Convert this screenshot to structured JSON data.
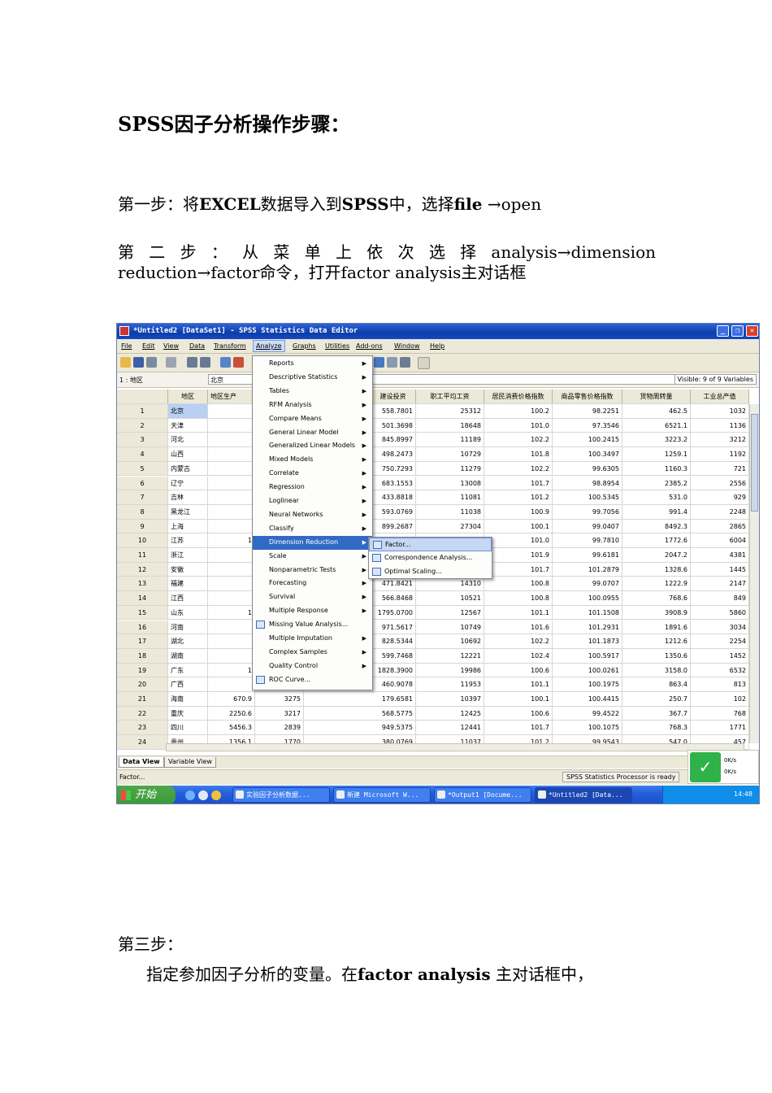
{
  "doc": {
    "heading": "SPSS因子分析操作步骤：",
    "step1_a": "第一步：将",
    "step1_b": "EXCEL",
    "step1_c": "数据导入到",
    "step1_d": "SPSS",
    "step1_e": "中，选择",
    "step1_f": "file",
    "step1_g": "→open",
    "step2": "第 二 步 ： 从 菜 单 上 依 次 选 择 analysis→dimension reduction→factor命令，打开factor analysis主对话框",
    "step3_title": "第三步：",
    "step3_a": "指定参加因子分析的变量。在",
    "step3_b": "factor analysis",
    "step3_c": "主对话框中，"
  },
  "app": {
    "title": "*Untitled2 [DataSet1] - SPSS Statistics Data Editor",
    "menus": [
      "File",
      "Edit",
      "View",
      "Data",
      "Transform",
      "Analyze",
      "Graphs",
      "Utilities",
      "Add-ons",
      "Window",
      "Help"
    ],
    "cell_ref": "1 : 地区",
    "cell_value": "北京",
    "visible": "Visible: 9 of 9 Variables",
    "columns": [
      "地区",
      "地区生产",
      "",
      "建设投资",
      "职工平均工资",
      "居民消费价格指数",
      "商品零售价格指数",
      "货物周转量",
      "工业总产值"
    ],
    "rows": [
      {
        "n": "1",
        "region": "北京",
        "gdp": "",
        "c3": "",
        "inv": "558.7801",
        "wage": "25312",
        "cpi": "100.2",
        "rpi": "98.2251",
        "freight": "462.5",
        "ind": "1032"
      },
      {
        "n": "2",
        "region": "天津",
        "gdp": "",
        "c3": "",
        "inv": "501.3698",
        "wage": "18648",
        "cpi": "101.0",
        "rpi": "97.3546",
        "freight": "6521.1",
        "ind": "1136"
      },
      {
        "n": "3",
        "region": "河北",
        "gdp": "",
        "c3": "",
        "inv": "845.8997",
        "wage": "11189",
        "cpi": "102.2",
        "rpi": "100.2415",
        "freight": "3223.2",
        "ind": "3212"
      },
      {
        "n": "4",
        "region": "山西",
        "gdp": "",
        "c3": "",
        "inv": "498.2473",
        "wage": "10729",
        "cpi": "101.8",
        "rpi": "100.3497",
        "freight": "1259.1",
        "ind": "1192"
      },
      {
        "n": "5",
        "region": "内蒙古",
        "gdp": "",
        "c3": "",
        "inv": "750.7293",
        "wage": "11279",
        "cpi": "102.2",
        "rpi": "99.6305",
        "freight": "1160.3",
        "ind": "721"
      },
      {
        "n": "6",
        "region": "辽宁",
        "gdp": "",
        "c3": "",
        "inv": "683.1553",
        "wage": "13008",
        "cpi": "101.7",
        "rpi": "98.8954",
        "freight": "2385.2",
        "ind": "2556"
      },
      {
        "n": "7",
        "region": "吉林",
        "gdp": "",
        "c3": "",
        "inv": "433.8818",
        "wage": "11081",
        "cpi": "101.2",
        "rpi": "100.5345",
        "freight": "531.0",
        "ind": "929"
      },
      {
        "n": "8",
        "region": "黑龙江",
        "gdp": "",
        "c3": "",
        "inv": "593.0769",
        "wage": "11038",
        "cpi": "100.9",
        "rpi": "99.7056",
        "freight": "991.4",
        "ind": "2248"
      },
      {
        "n": "9",
        "region": "上海",
        "gdp": "",
        "c3": "",
        "inv": "899.2687",
        "wage": "27304",
        "cpi": "100.1",
        "rpi": "99.0407",
        "freight": "8492.3",
        "ind": "2865"
      },
      {
        "n": "10",
        "region": "江苏",
        "gdp": "1",
        "c3": "",
        "inv": "",
        "wage": "",
        "cpi": "101.0",
        "rpi": "99.7810",
        "freight": "1772.6",
        "ind": "6004"
      },
      {
        "n": "11",
        "region": "浙江",
        "gdp": "",
        "c3": "",
        "inv": "",
        "wage": "",
        "cpi": "101.9",
        "rpi": "99.6181",
        "freight": "2047.2",
        "ind": "4381"
      },
      {
        "n": "12",
        "region": "安徽",
        "gdp": "",
        "c3": "",
        "inv": "",
        "wage": "",
        "cpi": "101.7",
        "rpi": "101.2879",
        "freight": "1328.6",
        "ind": "1445"
      },
      {
        "n": "13",
        "region": "福建",
        "gdp": "",
        "c3": "",
        "inv": "471.8421",
        "wage": "14310",
        "cpi": "100.8",
        "rpi": "99.0707",
        "freight": "1222.9",
        "ind": "2147"
      },
      {
        "n": "14",
        "region": "江西",
        "gdp": "",
        "c3": "",
        "inv": "566.8468",
        "wage": "10521",
        "cpi": "100.8",
        "rpi": "100.0955",
        "freight": "768.6",
        "ind": "849"
      },
      {
        "n": "15",
        "region": "山东",
        "gdp": "1",
        "c3": "",
        "inv": "1795.0700",
        "wage": "12567",
        "cpi": "101.1",
        "rpi": "101.1508",
        "freight": "3908.9",
        "ind": "5860"
      },
      {
        "n": "16",
        "region": "河南",
        "gdp": "",
        "c3": "",
        "inv": "971.5617",
        "wage": "10749",
        "cpi": "101.6",
        "rpi": "101.2931",
        "freight": "1891.6",
        "ind": "3034"
      },
      {
        "n": "17",
        "region": "湖北",
        "gdp": "",
        "c3": "",
        "inv": "828.5344",
        "wage": "10692",
        "cpi": "102.2",
        "rpi": "101.1873",
        "freight": "1212.6",
        "ind": "2254"
      },
      {
        "n": "18",
        "region": "湖南",
        "gdp": "",
        "c3": "",
        "inv": "599.7468",
        "wage": "12221",
        "cpi": "102.4",
        "rpi": "100.5917",
        "freight": "1350.6",
        "ind": "1452"
      },
      {
        "n": "19",
        "region": "广东",
        "gdp": "1",
        "c3": "",
        "inv": "1828.3900",
        "wage": "19986",
        "cpi": "100.6",
        "rpi": "100.0261",
        "freight": "3158.0",
        "ind": "6532"
      },
      {
        "n": "20",
        "region": "广西",
        "gdp": "",
        "c3": "",
        "inv": "460.9078",
        "wage": "11953",
        "cpi": "101.1",
        "rpi": "100.1975",
        "freight": "863.4",
        "ind": "813"
      },
      {
        "n": "21",
        "region": "海南",
        "gdp": "670.9",
        "c3": "3275",
        "inv": "179.6581",
        "wage": "10397",
        "cpi": "100.1",
        "rpi": "100.4415",
        "freight": "250.7",
        "ind": "102"
      },
      {
        "n": "22",
        "region": "重庆",
        "gdp": "2250.6",
        "c3": "3217",
        "inv": "568.5775",
        "wage": "12425",
        "cpi": "100.6",
        "rpi": "99.4522",
        "freight": "367.7",
        "ind": "768"
      },
      {
        "n": "23",
        "region": "四川",
        "gdp": "5456.3",
        "c3": "2839",
        "inv": "949.5375",
        "wage": "12441",
        "cpi": "101.7",
        "rpi": "100.1075",
        "freight": "768.3",
        "ind": "1771"
      },
      {
        "n": "24",
        "region": "贵州",
        "gdp": "1356.1",
        "c3": "1770",
        "inv": "380.0769",
        "wage": "11037",
        "cpi": "101.2",
        "rpi": "99.9543",
        "freight": "547.0",
        "ind": "457"
      }
    ],
    "analyze_menu": [
      "Reports",
      "Descriptive Statistics",
      "Tables",
      "RFM Analysis",
      "Compare Means",
      "General Linear Model",
      "Generalized Linear Models",
      "Mixed Models",
      "Correlate",
      "Regression",
      "Loglinear",
      "Neural Networks",
      "Classify",
      "Dimension Reduction",
      "Scale",
      "Nonparametric Tests",
      "Forecasting",
      "Survival",
      "Multiple Response",
      "Missing Value Analysis...",
      "Multiple Imputation",
      "Complex Samples",
      "Quality Control",
      "ROC Curve..."
    ],
    "submenu": [
      "Factor...",
      "Correspondence Analysis...",
      "Optimal Scaling..."
    ],
    "tabs": [
      "Data View",
      "Variable View"
    ],
    "status_left": "Factor...",
    "status_right": "SPSS Statistics  Processor is ready",
    "net_up": "0K/s",
    "net_down": "0K/s",
    "taskbar": {
      "start": "开始",
      "tasks": [
        "实验因子分析数据...",
        "新建 Microsoft W...",
        "*Output1 [Docume...",
        "*Untitled2 [Data..."
      ],
      "clock": "14:48"
    }
  }
}
